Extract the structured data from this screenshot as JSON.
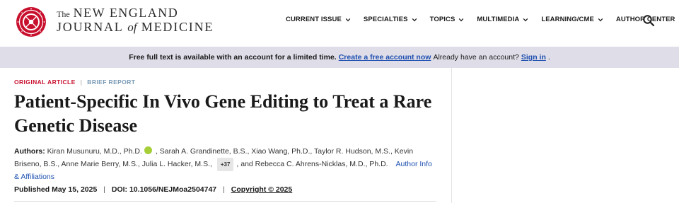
{
  "logo": {
    "the": "The",
    "line1": "NEW ENGLAND",
    "line2_a": "JOURNAL",
    "line2_of": "of",
    "line2_b": "MEDICINE",
    "seal_color": "#c8102e"
  },
  "nav": {
    "items": [
      {
        "label": "CURRENT ISSUE"
      },
      {
        "label": "SPECIALTIES"
      },
      {
        "label": "TOPICS"
      },
      {
        "label": "MULTIMEDIA"
      },
      {
        "label": "LEARNING/CME"
      },
      {
        "label": "AUTHOR CENTER"
      }
    ],
    "search_icon": "search-icon"
  },
  "banner": {
    "message": "Free full text is available with an account for a limited time.",
    "create_link": "Create a free account now",
    "already": "Already have an account?",
    "signin_link": "Sign in",
    "end": ".",
    "background": "#dfdde8",
    "link_color": "#1c4fb0"
  },
  "article": {
    "kicker_type": "ORIGINAL ARTICLE",
    "kicker_sep": "|",
    "kicker_sub": "BRIEF REPORT",
    "title": "Patient-Specific In Vivo Gene Editing to Treat a Rare Genetic Disease",
    "authors_label": "Authors:",
    "authors_part1": "Kiran Musunuru, M.D., Ph.D.",
    "authors_part2": ", Sarah A. Grandinette, B.S., Xiao Wang, Ph.D., Taylor R. Hudson, M.S., Kevin Briseno, B.S., Anne Marie Berry, M.S., Julia L. Hacker, M.S.,",
    "more_count": "+37",
    "authors_part3": ", and Rebecca C. Ahrens-Nicklas, M.D., Ph.D.",
    "affiliations_link": "Author Info & Affiliations",
    "published": "Published May 15, 2025",
    "pub_sep": "|",
    "doi": "DOI: 10.1056/NEJMoa2504747",
    "pub_sep2": "|",
    "copyright": "Copyright © 2025",
    "kicker_color": "#c8102e",
    "orcid_color": "#a6ce39"
  }
}
